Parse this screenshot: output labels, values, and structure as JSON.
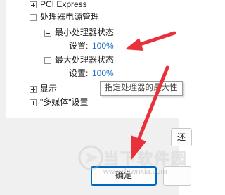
{
  "tree": {
    "items": [
      {
        "label": "PCI Express",
        "expander": "plus"
      },
      {
        "label": "处理器电源管理",
        "expander": "minus"
      },
      {
        "label": "最小处理器状态",
        "expander": "minus"
      },
      {
        "setting_label": "设置:",
        "setting_value": "100%"
      },
      {
        "label": "最大处理器状态",
        "expander": "minus"
      },
      {
        "setting_label": "设置:",
        "setting_value": "100%"
      },
      {
        "label": "显示",
        "expander": "plus"
      },
      {
        "label": "\"多媒体\"设置",
        "expander": "plus"
      }
    ]
  },
  "tooltip": {
    "text": "指定处理器的最大性"
  },
  "buttons": {
    "restore_label": "还",
    "ok_label": "确定",
    "cancel_label": ""
  },
  "watermark": {
    "text": "当下软件园",
    "sub": "www.downxia.com"
  },
  "annotations": {
    "arrow_color": "#e8313a"
  }
}
